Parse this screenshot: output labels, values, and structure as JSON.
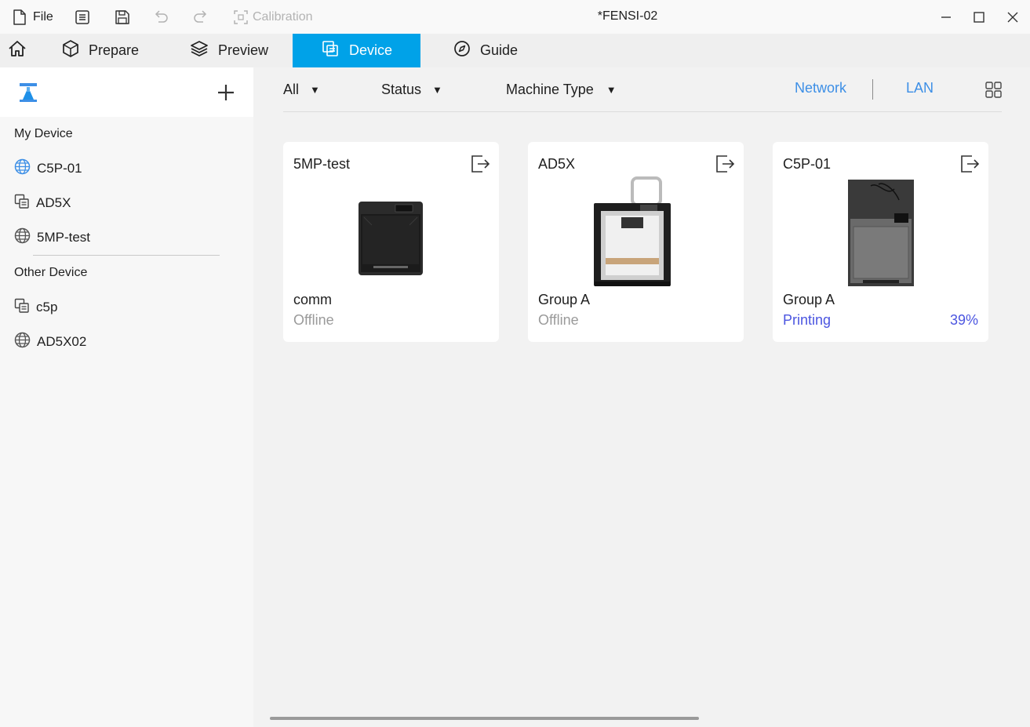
{
  "titlebar": {
    "file_label": "File",
    "calibration_label": "Calibration",
    "window_title": "*FENSI-02"
  },
  "tabs": {
    "prepare": "Prepare",
    "preview": "Preview",
    "device": "Device",
    "guide": "Guide",
    "active": "Device"
  },
  "sidebar": {
    "my_device_title": "My Device",
    "my_devices": [
      {
        "name": "C5P-01",
        "icon": "globe-icon-blue"
      },
      {
        "name": "AD5X",
        "icon": "lan-device-icon"
      },
      {
        "name": "5MP-test",
        "icon": "globe-icon"
      }
    ],
    "other_device_title": "Other Device",
    "other_devices": [
      {
        "name": "c5p",
        "icon": "lan-device-icon"
      },
      {
        "name": "AD5X02",
        "icon": "globe-icon"
      }
    ]
  },
  "filters": {
    "all": "All",
    "status": "Status",
    "machine_type": "Machine Type",
    "network": "Network",
    "lan": "LAN"
  },
  "cards": [
    {
      "name": "5MP-test",
      "group": "comm",
      "status": "Offline"
    },
    {
      "name": "AD5X",
      "group": "Group A",
      "status": "Offline"
    },
    {
      "name": "C5P-01",
      "group": "Group A",
      "status": "Printing",
      "progress": "39%"
    }
  ],
  "colors": {
    "accent": "#00a2e8",
    "link": "#3d8fe6",
    "printing": "#4b55e0",
    "offline": "#9a9a9a"
  }
}
